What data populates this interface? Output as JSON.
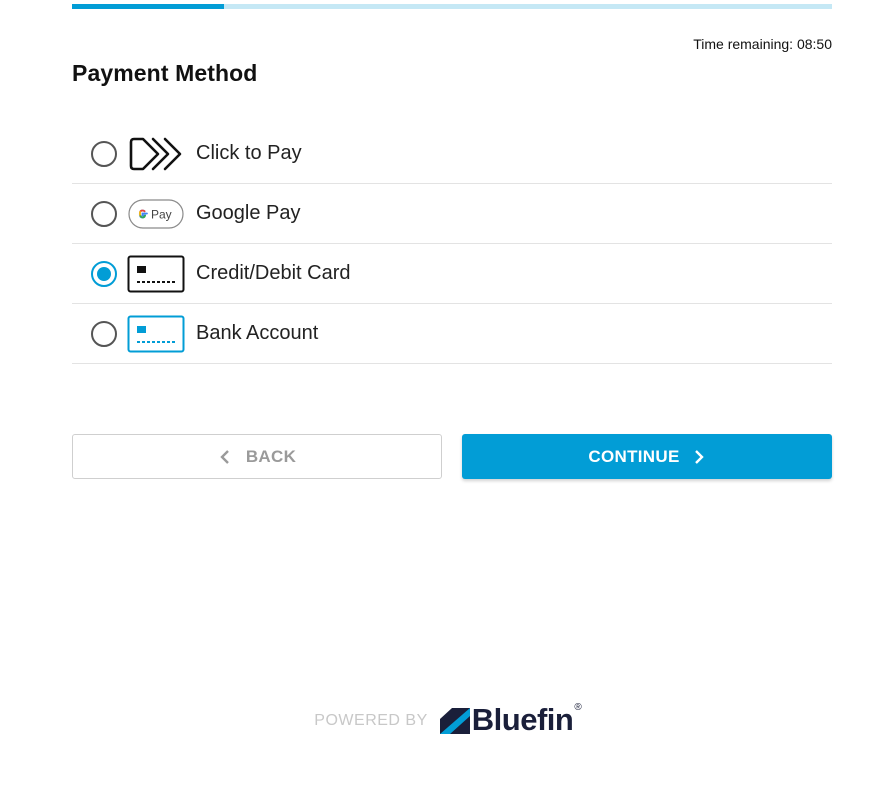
{
  "progress": {
    "fraction": 0.2
  },
  "timer": {
    "text": "Time remaining: 08:50"
  },
  "page": {
    "title": "Payment Method"
  },
  "methods": [
    {
      "id": "click-to-pay",
      "label": "Click to Pay",
      "icon": "click-to-pay-icon",
      "selected": false
    },
    {
      "id": "google-pay",
      "label": "Google Pay",
      "icon": "google-pay-icon",
      "selected": false
    },
    {
      "id": "card",
      "label": "Credit/Debit Card",
      "icon": "credit-card-icon",
      "selected": true
    },
    {
      "id": "bank",
      "label": "Bank Account",
      "icon": "bank-account-icon",
      "selected": false
    }
  ],
  "buttons": {
    "back_label": "BACK",
    "continue_label": "CONTINUE"
  },
  "footer": {
    "powered_by": "POWERED BY",
    "brand": "Bluefin",
    "registered_mark": "®"
  },
  "colors": {
    "accent": "#029dd6",
    "progress_track": "#c5e8f5",
    "brand_dark": "#1a1f3a"
  }
}
